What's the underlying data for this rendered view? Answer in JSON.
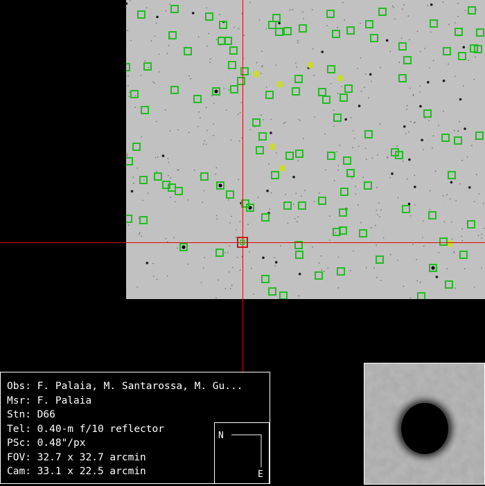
{
  "info_panel": {
    "lines": [
      "Obs: F. Palaia, M. Santarossa, M. Gu...",
      "Msr: F. Palaia",
      "Stn: D66",
      "Tel: 0.40-m f/10 reflector",
      "PSc: 0.48\"/px",
      "FOV: 32.7 x 32.7 arcmin",
      "Cam: 33.1 x 22.5 arcmin"
    ]
  },
  "compass": {
    "north": "N",
    "east": "E"
  },
  "colors": {
    "star_marker": "#22bb22",
    "target_marker": "#d01010",
    "crosshair": "#e00000",
    "moving_object_track": "#ccdd22",
    "sky_background": "#b9b9b9",
    "panel_border": "#ffffff"
  },
  "icons": [
    "compass-rose-icon",
    "crosshair-icon"
  ]
}
